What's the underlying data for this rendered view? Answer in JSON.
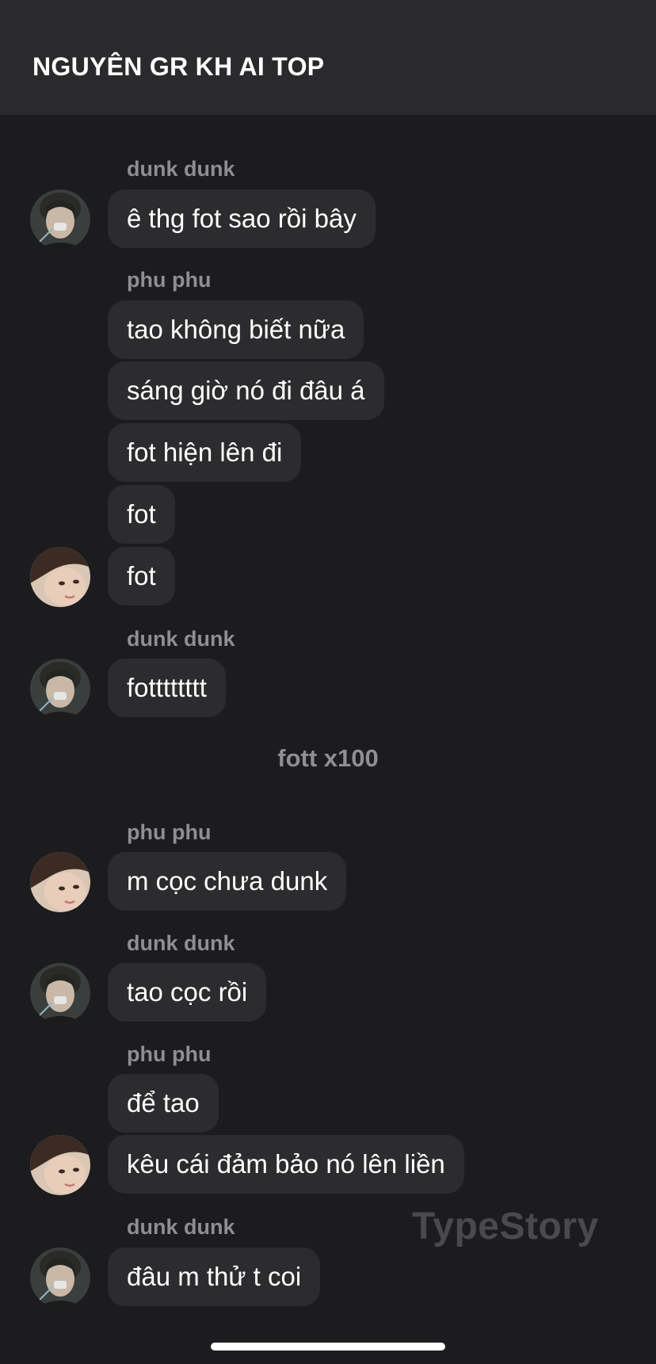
{
  "chat": {
    "title": "NGUYÊN GR KH AI TOP"
  },
  "messages": [
    {
      "sender": "dunk dunk",
      "texts": [
        "ê thg fot sao rồi bây"
      ]
    },
    {
      "sender": "phu phu",
      "texts": [
        "tao không biết nữa",
        "sáng giờ nó đi đâu á",
        "fot hiện lên đi",
        "fot",
        "fot"
      ]
    },
    {
      "sender": "dunk dunk",
      "texts": [
        "fotttttttt"
      ]
    },
    {
      "system": "fott x100"
    },
    {
      "sender": "phu phu",
      "texts": [
        "m cọc chưa dunk"
      ]
    },
    {
      "sender": "dunk dunk",
      "texts": [
        "tao cọc rồi"
      ]
    },
    {
      "sender": "phu phu",
      "texts": [
        "để tao",
        "kêu cái đảm bảo nó lên liền"
      ]
    },
    {
      "sender": "dunk dunk",
      "texts": [
        "đâu m thử t coi"
      ]
    }
  ],
  "watermark": "TypeStory",
  "colors": {
    "background": "#1c1c1e",
    "header": "#2a2a2d",
    "bubble": "#2c2c2e",
    "sender_name": "#8e8e93",
    "text": "#ffffff"
  },
  "icons": {
    "avatar_dunk": "avatar-dunk-dunk-photo",
    "avatar_phu": "avatar-phu-phu-photo"
  }
}
